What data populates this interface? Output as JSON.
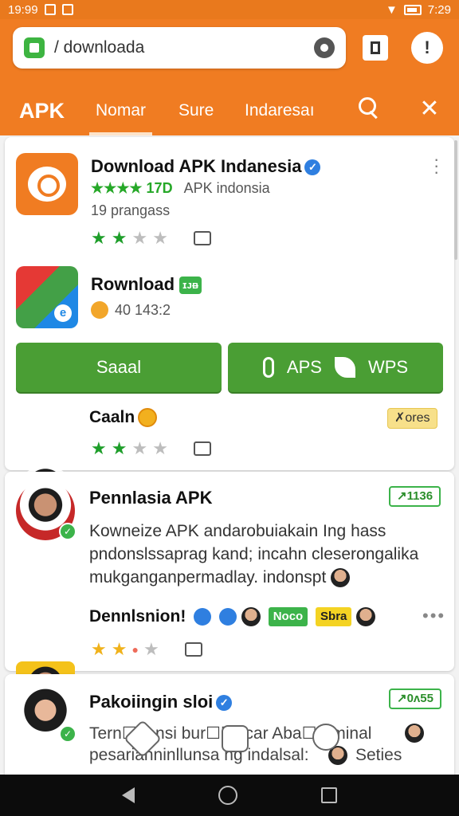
{
  "status_bar": {
    "time": "19:99",
    "right_time": "7:29"
  },
  "browser": {
    "url": "/ downloada"
  },
  "tabs": [
    {
      "label": "APK"
    },
    {
      "label": "Nomar"
    },
    {
      "label": "Sure"
    },
    {
      "label": "Indaresaı"
    }
  ],
  "card1": {
    "app1": {
      "title": "Download APK Indanesia",
      "rating": "★★★★ 17D",
      "developer": "APK indonsia",
      "meta": "19 prangass"
    },
    "app2": {
      "title": "Rownload",
      "badge": "ɪᴊᴃ",
      "meta": "40 143:2"
    },
    "buttons": {
      "primary": "Saaal",
      "secondary_a": "APS",
      "secondary_b": "WPS"
    },
    "item3": {
      "title": "Caaln",
      "pill": "✗ores"
    }
  },
  "card2": {
    "item1": {
      "title": "Pennlasia APK",
      "pill": "↗1136",
      "body": "Kowneize APK andarobuiakain Ing hass pndonslssaprag kand; incahn cleserongalika mukganganpermadlay. indonspt"
    },
    "item2": {
      "title": "Dennlsnion!",
      "tag_green": "Noco",
      "tag_yellow": "Sbra"
    }
  },
  "card3": {
    "item1": {
      "title": "Pakoiingin sloi",
      "pill": "↗0ʌ55",
      "body_line1": "Tern☐bensi bur☐☐acar Aba☐☐minal",
      "body_line2": "pesarianninllunsa ng indalsal:",
      "body_line2_end": "Seties"
    }
  },
  "colors": {
    "brand_orange": "#f07c22",
    "button_green": "#4a9e34",
    "badge_green": "#3cb34a",
    "verified_blue": "#2f7fe0"
  }
}
